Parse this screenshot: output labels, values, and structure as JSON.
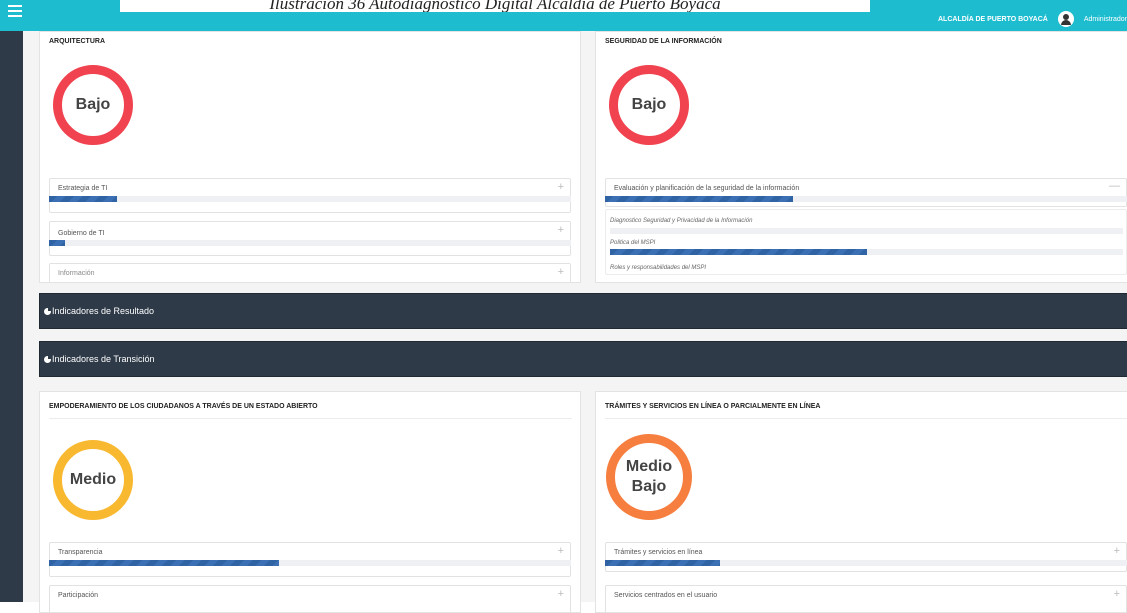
{
  "caption": "Ilustración 36 Autodiagnóstico Digital Alcaldía de Puerto Boyacá",
  "topbar": {
    "org_name": "ALCALDÍA DE PUERTO BOYACÁ",
    "user_name": "Administrador"
  },
  "panels": {
    "arquitectura": {
      "title": "ARQUITECTURA",
      "level": "Bajo",
      "items": [
        {
          "label": "Estrategia de TI",
          "progress": 0.13
        },
        {
          "label": "Gobierno de TI",
          "progress": 0.03
        },
        {
          "label": "Información"
        }
      ]
    },
    "seguridad": {
      "title": "SEGURIDAD DE LA INFORMACIÓN",
      "level": "Bajo",
      "items": [
        {
          "label": "Evaluación y planificación de la seguridad de la información",
          "progress": 0.36
        }
      ],
      "subitems": [
        {
          "label": "Diagnostico Seguridad y Privacidad de la Información"
        },
        {
          "label": "Politica del MSPI",
          "progress": 0.5
        },
        {
          "label": "Roles y responsabilidades del MSPI"
        }
      ]
    },
    "empoderamiento": {
      "title": "EMPODERAMIENTO DE LOS CIUDADANOS A TRAVÉS DE UN ESTADO ABIERTO",
      "level": "Medio",
      "items": [
        {
          "label": "Transparencia",
          "progress": 0.44
        },
        {
          "label": "Participación"
        }
      ]
    },
    "tramites": {
      "title": "TRÁMITES Y SERVICIOS EN LÍNEA O PARCIALMENTE EN LÍNEA",
      "level_line1": "Medio",
      "level_line2": "Bajo",
      "items": [
        {
          "label": "Trámites y servicios en línea",
          "progress": 0.22
        },
        {
          "label": "Servicios centrados en el usuario"
        }
      ]
    }
  },
  "bands": {
    "resultado": "Indicadores de Resultado",
    "transicion": "Indicadores de Transición"
  },
  "plus_symbol": "+",
  "minus_symbol": "—",
  "colors": {
    "low": "#f0434f",
    "medium": "#f8b931",
    "medium_low": "#f67e3f",
    "topbar": "#1ebccf",
    "band": "#2e3a48"
  }
}
